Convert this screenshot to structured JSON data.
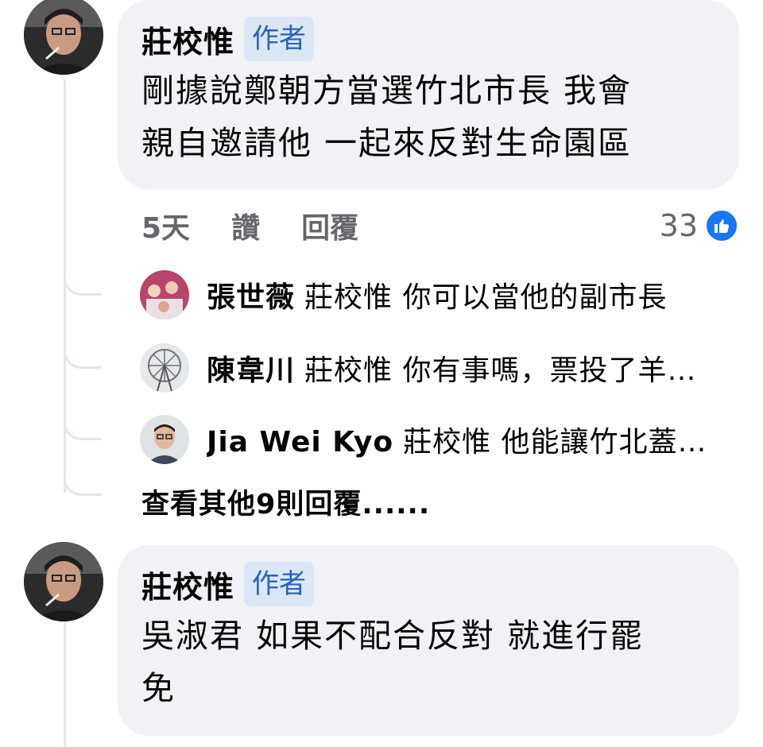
{
  "comments": [
    {
      "author": "莊校惟",
      "badge": "作者",
      "text_lines": [
        "剛據說鄭朝方當選竹北市長 我會",
        "親自邀請他 一起來反對生命園區"
      ],
      "time": "5天",
      "like_label": "讚",
      "reply_label": "回覆",
      "reaction_count": "33",
      "avatar_icon": "profile-photo-smoker"
    },
    {
      "author": "莊校惟",
      "badge": "作者",
      "text_lines": [
        "吳淑君 如果不配合反對 就進行罷",
        "免"
      ],
      "avatar_icon": "profile-photo-smoker"
    }
  ],
  "replies": [
    {
      "name": "張世薇",
      "text": "莊校惟 你可以當他的副市長",
      "avatar_icon": "group-photo-avatar"
    },
    {
      "name": "陳韋川",
      "text": "莊校惟 你有事嗎，票投了羊…",
      "avatar_icon": "ferris-wheel-avatar"
    },
    {
      "name": "Jia Wei  Kyo",
      "text": "莊校惟 他能讓竹北蓋…",
      "avatar_icon": "man-glasses-avatar"
    }
  ],
  "view_more": "查看其他9則回覆......",
  "colors": {
    "bubble": "#f0f2f5",
    "badge_bg": "#dbe7f6",
    "badge_text": "#2a62b8",
    "like_blue": "#1877f2",
    "meta_gray": "#65676b"
  }
}
